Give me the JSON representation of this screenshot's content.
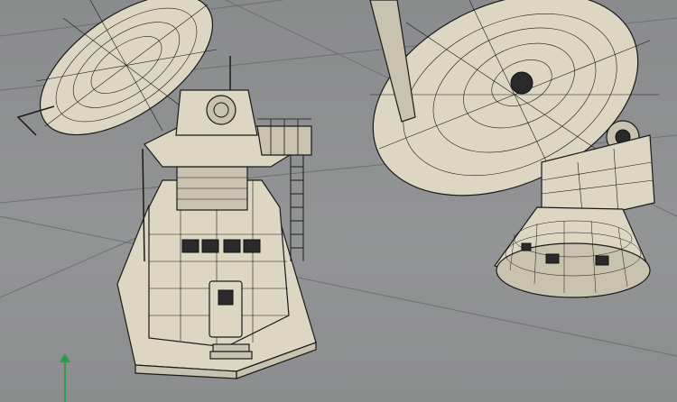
{
  "viewport": {
    "background": "#8f9091",
    "model_color": "#ddd6c3",
    "wire_color": "#1a1a1a",
    "axis_gizmo": {
      "color": "#2e9b4a",
      "icon": "axis-y-arrow-icon"
    }
  }
}
